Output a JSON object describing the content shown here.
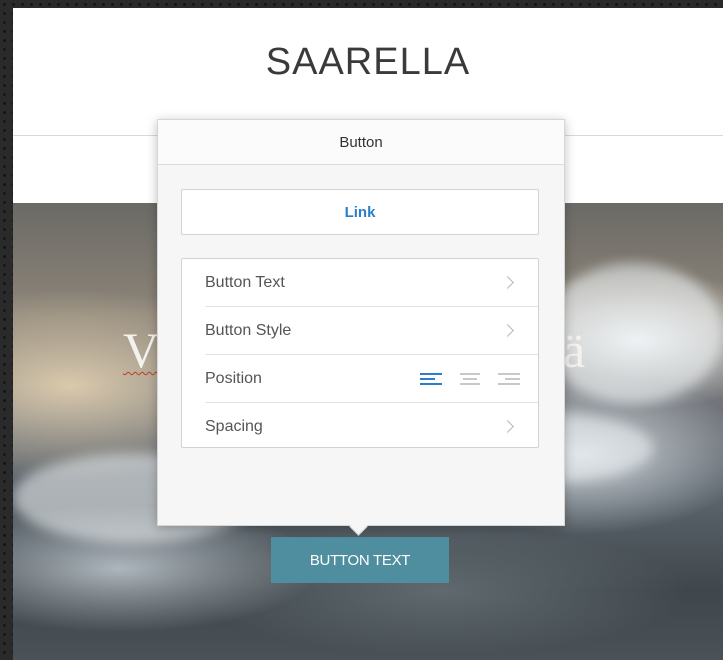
{
  "site": {
    "title": "SAARELLA"
  },
  "hero": {
    "heading_left": "V",
    "heading_right": "ä",
    "button_label": "BUTTON TEXT"
  },
  "popover": {
    "title": "Button",
    "link_label": "Link",
    "rows": [
      {
        "label": "Button Text",
        "control": "chevron-right-icon"
      },
      {
        "label": "Button Style",
        "control": "chevron-right-icon"
      },
      {
        "label": "Position",
        "control": "alignment",
        "selected": "left"
      },
      {
        "label": "Spacing",
        "control": "chevron-right-icon"
      }
    ]
  },
  "colors": {
    "accent_blue": "#2a7fc9",
    "hero_button": "#4f8e9e"
  }
}
